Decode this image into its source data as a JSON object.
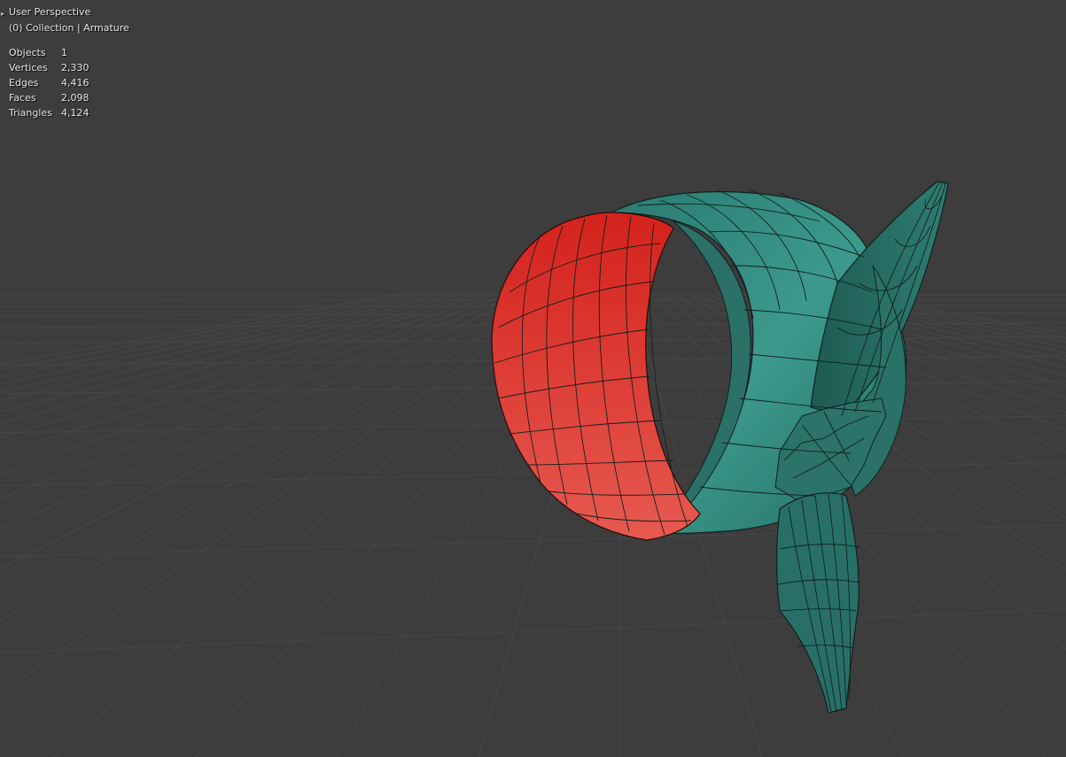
{
  "viewport": {
    "view_name": "User Perspective",
    "collection_text": "(0) Collection | Armature",
    "stats": [
      {
        "label": "Objects",
        "value": "1"
      },
      {
        "label": "Vertices",
        "value": "2,330"
      },
      {
        "label": "Edges",
        "value": "4,416"
      },
      {
        "label": "Faces",
        "value": "2,098"
      },
      {
        "label": "Triangles",
        "value": "4,124"
      }
    ]
  },
  "colors": {
    "background": "#3d3d3d",
    "grid": "#474747",
    "mesh_teal": "#2f7e73",
    "mesh_teal_light": "#3d9a8c",
    "mesh_teal_dark": "#1f5c54",
    "mesh_red": "#dc3a32",
    "mesh_red_light": "#e44c44",
    "wire": "#12201f"
  },
  "icons": {
    "header_toggle": "chevron-right-icon"
  }
}
